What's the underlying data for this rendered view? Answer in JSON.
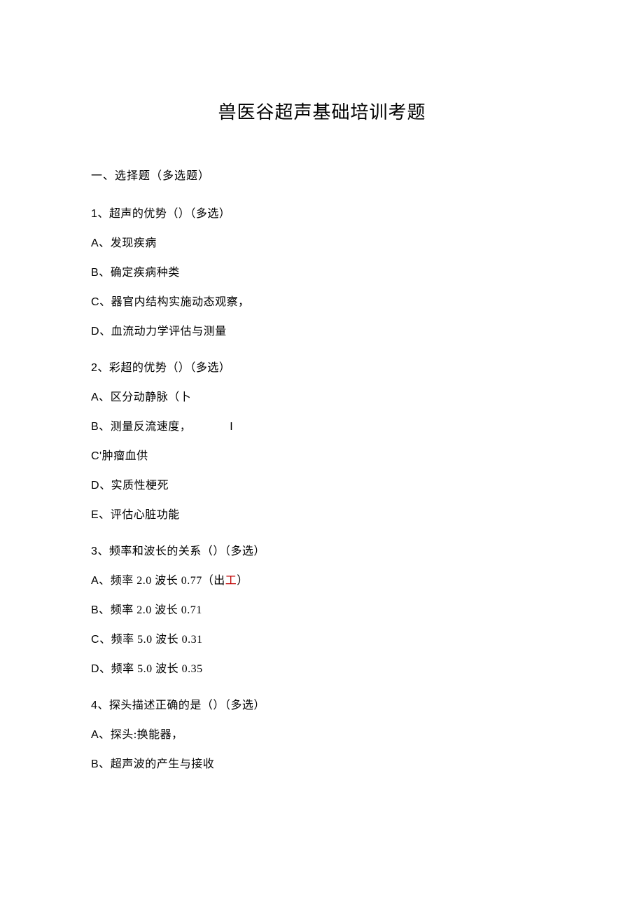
{
  "title": "兽医谷超声基础培训考题",
  "section1": {
    "heading": "一、选择题（多选题）",
    "questions": [
      {
        "num_latin": "1",
        "prompt_cn": "、超声的优势（）（多选）",
        "options": [
          {
            "label": "A",
            "sep_cn": "、",
            "text_cn": "发现疾病"
          },
          {
            "label": "B",
            "sep_cn": "、",
            "text_cn": "确定疾病种类"
          },
          {
            "label": "C",
            "sep_cn": "、",
            "text_cn": "器官内结构实施动态观察，"
          },
          {
            "label": "D",
            "sep_cn": "、",
            "text_cn": "血流动力学评估与测量"
          }
        ]
      },
      {
        "num_latin": "2",
        "prompt_cn": "、彩超的优势（）（多选）",
        "options": [
          {
            "label": "A",
            "sep_cn": "、",
            "text_cn": "区分动静脉（卜"
          },
          {
            "label": "B",
            "sep_cn": "、",
            "text_cn": "测量反流速度，",
            "trail": "I"
          },
          {
            "label": "C'",
            "sep_cn": "",
            "text_cn": "肿瘤血供"
          },
          {
            "label": "D",
            "sep_cn": "、",
            "text_cn": "实质性梗死"
          },
          {
            "label": "E",
            "sep_cn": "、",
            "text_cn": "评估心脏功能"
          }
        ]
      },
      {
        "num_latin": "3",
        "prompt_cn": "、频率和波长的关系（）（多选）",
        "options": [
          {
            "label": "A",
            "sep_cn": "、",
            "mix": "频率 2.0 波长 0.77（出",
            "red_cn": "工",
            "close_cn": "）"
          },
          {
            "label": "B",
            "sep_cn": "、",
            "mix": "频率 2.0 波长 0.71"
          },
          {
            "label": "C",
            "sep_cn": "、",
            "mix": "频率 5.0 波长 0.31"
          },
          {
            "label": "D",
            "sep_cn": "、",
            "mix": "频率 5.0 波长 0.35"
          }
        ]
      },
      {
        "num_latin": "4",
        "prompt_cn": "、探头描述正确的是（）（多选）",
        "options": [
          {
            "label": "A",
            "sep_cn": "、",
            "mix": "探头:换能器，"
          },
          {
            "label": "B",
            "sep_cn": "、",
            "text_cn": "超声波的产生与接收"
          }
        ]
      }
    ]
  }
}
